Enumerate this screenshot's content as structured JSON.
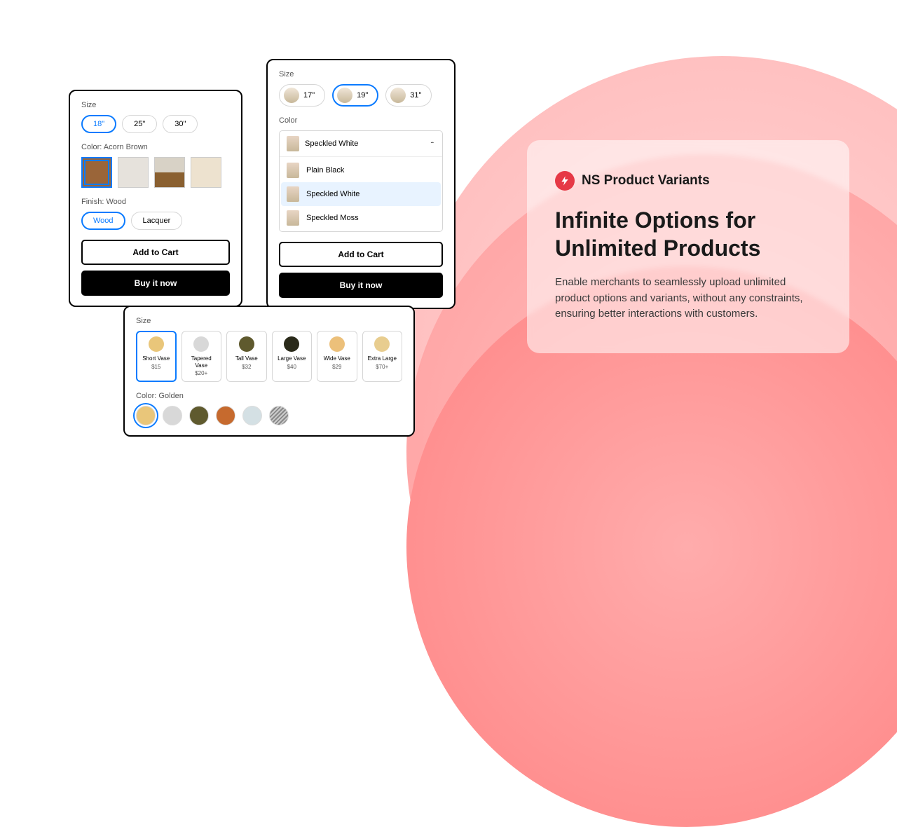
{
  "cardA": {
    "sizeLabel": "Size",
    "sizes": [
      "18\"",
      "25\"",
      "30\""
    ],
    "selectedSize": 0,
    "colorLabel": "Color: Acorn Brown",
    "swatches": [
      "#9a6539",
      "#e6e2dc",
      "#a1793f",
      "#ede2cf"
    ],
    "selectedSwatch": 0,
    "finishLabel": "Finish: Wood",
    "finishes": [
      "Wood",
      "Lacquer"
    ],
    "selectedFinish": 0,
    "addToCart": "Add to Cart",
    "buyNow": "Buy it now"
  },
  "cardB": {
    "sizeLabel": "Size",
    "sizes": [
      "17\"",
      "19\"",
      "31\""
    ],
    "selectedSize": 1,
    "colorLabel": "Color",
    "ddSelected": "Speckled White",
    "ddOptions": [
      "Plain Black",
      "Speckled White",
      "Speckled Moss"
    ],
    "ddActive": 1,
    "addToCart": "Add to Cart",
    "buyNow": "Buy it now"
  },
  "cardC": {
    "sizeLabel": "Size",
    "tiles": [
      {
        "name": "Short Vase",
        "price": "$15",
        "color": "#e9c67a"
      },
      {
        "name": "Tapered Vase",
        "price": "$20+",
        "color": "#d8d8d8"
      },
      {
        "name": "Tall Vase",
        "price": "$32",
        "color": "#5f5a2e"
      },
      {
        "name": "Large Vase",
        "price": "$40",
        "color": "#2a2a1a"
      },
      {
        "name": "Wide Vase",
        "price": "$29",
        "color": "#ecc07a"
      },
      {
        "name": "Extra Large",
        "price": "$70+",
        "color": "#e8cd8f"
      }
    ],
    "selectedTile": 0,
    "colorLabel": "Color: Golden",
    "dots": [
      "#e9c67a",
      "#d8d8d8",
      "#5f5a2e",
      "#c66a2e",
      "#d4e0e4",
      "#c0c0c0"
    ],
    "selectedDot": 0
  },
  "panel": {
    "brand": "NS Product Variants",
    "headline": "Infinite Options for Unlimited Products",
    "desc": "Enable merchants to seamlessly upload unlimited product options and variants, without any constraints, ensuring better interactions with customers."
  }
}
